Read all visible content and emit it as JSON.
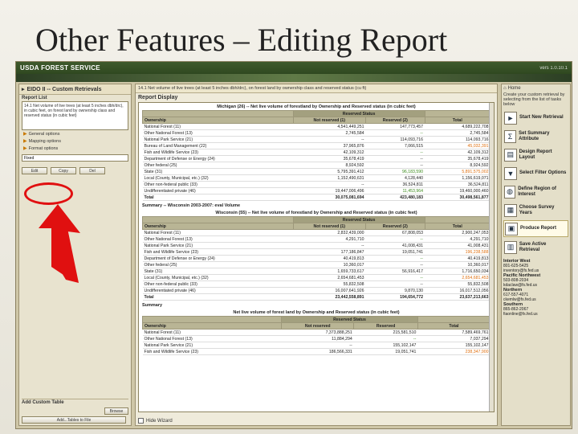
{
  "slide": {
    "title": "Other Features – Editing Report"
  },
  "app": {
    "brand": "USDA FOREST SERVICE",
    "version": "vers 1.0.10.1"
  },
  "left": {
    "title": "EIDO II -- Custom Retrievals",
    "report_list_label": "Report List",
    "report_text": "14.1 Net volume of live trees (at least 5 inches dbh/drc), in cubic feet, on forest land by ownership class and reserved status (in cubic feet)",
    "menu": [
      "General options",
      "Mapping options",
      "Format options"
    ],
    "selected_format": "Fixed",
    "buttons": {
      "edit": "Edit",
      "copy": "Copy",
      "delete": "Del"
    },
    "add_custom_table": "Add Custom Table",
    "browse": "Browse",
    "add_tables": "Add...Tables to File"
  },
  "center": {
    "top_line": "14.1 Net volume of live trees (at least 5 inches dbh/drc), on forest land by ownership class and reserved status (cu ft)",
    "display_title": "Report Display",
    "footer_checkbox": "Hide Wizard",
    "tables": [
      {
        "title": "Michigan (26) -- Net live volume of forestland by Ownership and Reserved status (in cubic feet)",
        "section": "",
        "group_header": "Reserved Status",
        "columns": [
          "Ownership",
          "Not reserved (1)",
          "Reserved (2)",
          "Total"
        ],
        "rows": [
          [
            "National Forest (11)",
            "4,541,449,251",
            "147,773,457",
            "4,689,222,708"
          ],
          [
            "Other National Forest (13)",
            "2,745,584",
            "--",
            "2,745,584"
          ],
          [
            "National Park Service (21)",
            "--",
            "114,093,716",
            "114,093,716"
          ],
          [
            "Bureau of Land Management (22)",
            "37,965,876",
            "7,066,515",
            "45,032,391"
          ],
          [
            "Fish and Wildlife Service (23)",
            "42,109,312",
            "--",
            "42,109,312"
          ],
          [
            "Department of Defense or Energy (24)",
            "35,678,419",
            "--",
            "35,678,419"
          ],
          [
            "Other federal (25)",
            "8,924,592",
            "--",
            "8,924,592"
          ],
          [
            "State (31)",
            "5,795,391,412",
            "96,183,590",
            "5,891,575,002"
          ],
          [
            "Local (County, Municipal, etc.) (32)",
            "1,152,490,631",
            "4,128,440",
            "1,156,619,071"
          ],
          [
            "Other non-federal public (33)",
            "--",
            "36,524,811",
            "36,524,811"
          ],
          [
            "Undifferentiated private (46)",
            "19,447,006,496",
            "11,453,964",
            "19,460,000,460"
          ]
        ],
        "total": [
          "Total",
          "30,075,081,694",
          "423,480,183",
          "30,498,561,877"
        ]
      },
      {
        "title": "Wisconsin (55) -- Net live volume of forestland by Ownership and Reserved status (in cubic feet)",
        "section": "Summary -- Wisconsin 2003-2007: eval Volume",
        "group_header": "Reserved Status",
        "columns": [
          "Ownership",
          "Not reserved (1)",
          "Reserved (2)",
          "Total"
        ],
        "rows": [
          [
            "National Forest (11)",
            "2,832,439,000",
            "67,808,053",
            "2,900,247,053"
          ],
          [
            "Other National Forest (13)",
            "4,291,710",
            "--",
            "4,291,710"
          ],
          [
            "National Park Service (21)",
            "--",
            "41,008,431",
            "41,008,431"
          ],
          [
            "Fish and Wildlife Service (23)",
            "177,186,847",
            "19,051,741",
            "196,238,588"
          ],
          [
            "Department of Defense or Energy (24)",
            "40,419,813",
            "--",
            "40,419,813"
          ],
          [
            "Other federal (25)",
            "10,360,017",
            "--",
            "10,360,017"
          ],
          [
            "State (31)",
            "1,659,733,617",
            "56,916,417",
            "1,716,650,034"
          ],
          [
            "Local (County, Municipal, etc.) (32)",
            "2,654,681,453",
            "--",
            "2,654,681,453"
          ],
          [
            "Other non-federal public (33)",
            "55,832,508",
            "--",
            "55,832,508"
          ],
          [
            "Undifferentiated private (46)",
            "16,007,641,926",
            "9,870,130",
            "16,017,512,056"
          ]
        ],
        "total": [
          "Total",
          "23,442,558,891",
          "194,654,772",
          "23,637,213,663"
        ]
      },
      {
        "title": "Net live volume of forest land by Ownership and Reserved status (in cubic feet)",
        "section": "Summary",
        "group_header": "Reserved Status",
        "columns": [
          "Ownership",
          "Not reserved",
          "Reserved",
          "Total"
        ],
        "rows": [
          [
            "National Forest (11)",
            "7,373,888,251",
            "215,581,510",
            "7,589,469,761"
          ],
          [
            "Other National Forest (13)",
            "11,884,294",
            "--",
            "7,037,294"
          ],
          [
            "National Park Service (21)",
            "--",
            "155,102,147",
            "155,102,147"
          ],
          [
            "Fish and Wildlife Service (23)",
            "186,566,331",
            "19,051,741",
            "238,347,900"
          ]
        ],
        "total": null
      }
    ]
  },
  "right": {
    "home": "Home",
    "intro": "Create your custom retrieval by selecting from the list of tasks below",
    "tasks": [
      {
        "label": "Start New Retrieval",
        "icon": "►"
      },
      {
        "label": "Set Summary Attribute",
        "icon": "Σ"
      },
      {
        "label": "Design Report Layout",
        "icon": "▤"
      },
      {
        "label": "Select Filter Options",
        "icon": "▼"
      },
      {
        "label": "Define Region of Interest",
        "icon": "◍"
      },
      {
        "label": "Choose Survey Years",
        "icon": "▦"
      },
      {
        "label": "Produce Report",
        "icon": "▣"
      },
      {
        "label": "Save Active Retrieval",
        "icon": "▥"
      }
    ],
    "contacts": [
      {
        "region": "Interior West",
        "lines": [
          "801-625-5425",
          "inventory@fs.fed.us"
        ]
      },
      {
        "region": "Pacific Northwest",
        "lines": [
          "503-808-2034",
          "kdaclaw@fs.fed.us"
        ]
      },
      {
        "region": "Northern",
        "lines": [
          "617-557-4071",
          "ckemlw@fs.fed.us"
        ]
      },
      {
        "region": "Southern",
        "lines": [
          "865-862-2067",
          "fiaonline@fs.fed.us"
        ]
      }
    ]
  },
  "annotation_colors": {
    "highlight": "#e01010"
  }
}
